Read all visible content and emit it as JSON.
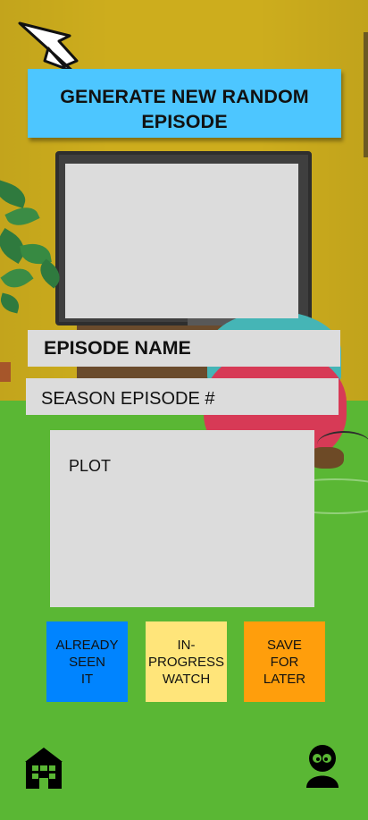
{
  "header": {
    "generate_button": "GENERATE NEW RANDOM EPISODE"
  },
  "episode": {
    "name_label": "EPISODE NAME",
    "season_episode_label": "SEASON EPISODE #",
    "plot_label": "PLOT"
  },
  "status_buttons": {
    "seen": "ALREADY\nSEEN\nIT",
    "watching": "IN-\nPROGRESS\nWATCH",
    "later": "SAVE\nFOR\nLATER"
  },
  "nav": {
    "home_icon": "home-building-icon",
    "profile_icon": "user-profile-icon"
  },
  "colors": {
    "generate_button": "#4dc6ff",
    "seen_button": "#0084ff",
    "watching_button": "#ffe57a",
    "later_button": "#ff9e0c",
    "content_box": "#dcdcdc",
    "wall": "#cdad1d",
    "floor": "#5ab734"
  }
}
